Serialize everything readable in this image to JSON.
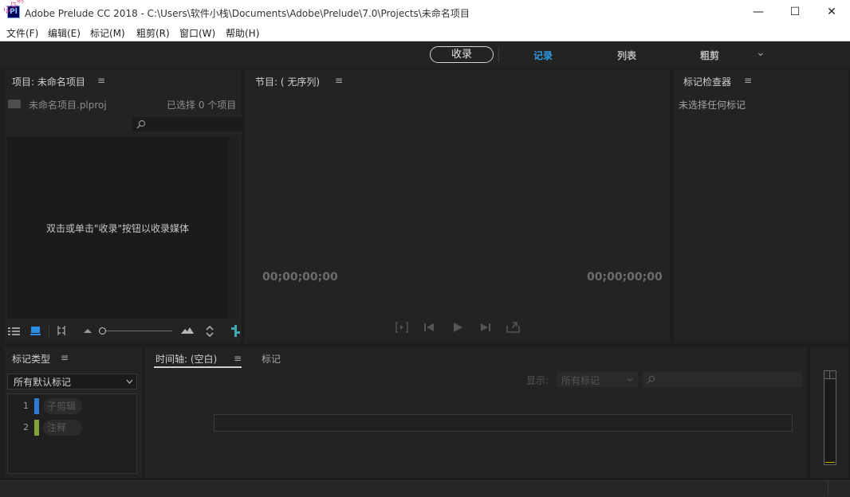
{
  "window": {
    "app_icon": "Pl",
    "title": "Adobe Prelude CC 2018 - C:\\Users\\软件小栈\\Documents\\Adobe\\Prelude\\7.0\\Projects\\未命名项目",
    "minimize_glyph": "—",
    "maximize_glyph": "☐",
    "close_glyph": "✕"
  },
  "watermark": "公众号:软件小栈",
  "menu": [
    "文件(F)",
    "编辑(E)",
    "标记(M)",
    "粗剪(R)",
    "窗口(W)",
    "帮助(H)"
  ],
  "workspace": {
    "ingest_label": "收录",
    "tabs": [
      "记录",
      "列表",
      "粗剪"
    ],
    "active_tab_color": "#2d9ce6",
    "more_glyph": "⌄"
  },
  "project_panel": {
    "title": "项目: 未命名项目",
    "menu_glyph": "≡",
    "file_name": "未命名项目.plproj",
    "selection_status": "已选择 0 个项目",
    "search_placeholder": "",
    "empty_hint": "双击或单击\"收录\"按钮以收录媒体"
  },
  "program_panel": {
    "title": "节目: ( 无序列)",
    "menu_glyph": "≡",
    "timecode_left": "00;00;00;00",
    "timecode_right": "00;00;00;00"
  },
  "marker_inspector": {
    "title": "标记检查器",
    "menu_glyph": "≡",
    "empty_text": "未选择任何标记"
  },
  "marker_type_panel": {
    "title": "标记类型",
    "menu_glyph": "≡",
    "dropdown_value": "所有默认标记",
    "items": [
      {
        "index": "1",
        "label": "子剪辑",
        "color": "#2f7bd0"
      },
      {
        "index": "2",
        "label": "注释",
        "color": "#7fa23a"
      }
    ]
  },
  "timeline_panel": {
    "tab_label": "时间轴: (空白)",
    "menu_glyph": "≡",
    "markers_tab": "标记",
    "show_label": "显示:",
    "show_value": "所有标记",
    "search_placeholder": ""
  }
}
